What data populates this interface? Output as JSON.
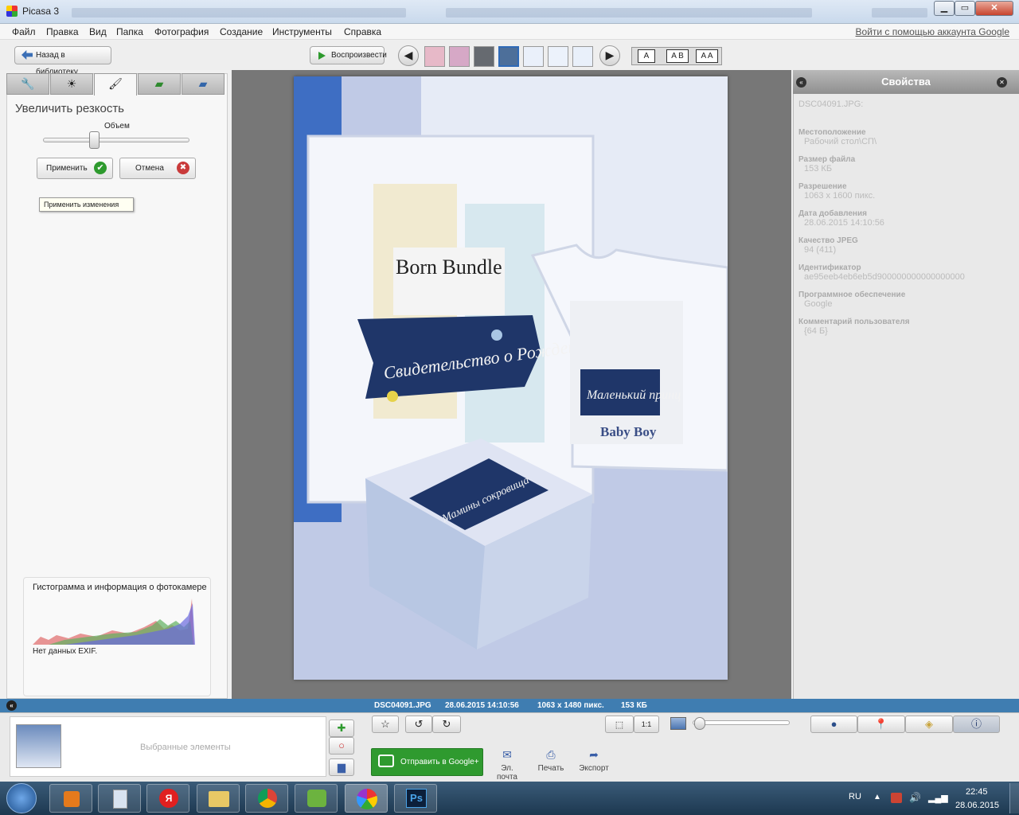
{
  "window": {
    "title": "Picasa 3",
    "minimize": "▁",
    "maximize": "▭",
    "close": "✕"
  },
  "menu": [
    "Файл",
    "Правка",
    "Вид",
    "Папка",
    "Фотография",
    "Создание",
    "Инструменты",
    "Справка"
  ],
  "signin": "Войти с помощью аккаунта Google",
  "toolbar": {
    "back_label": "Назад в библиотеку",
    "play_label": "Воспроизвести",
    "prev": "◀",
    "next": "▶",
    "caption_single": "A",
    "caption_ab": "A B",
    "caption_aa": "A A"
  },
  "left": {
    "tool_title": "Увеличить резкость",
    "slider_label": "Объем",
    "slider_value": 0.35,
    "apply_label": "Применить",
    "cancel_label": "Отмена",
    "tooltip": "Применить изменения",
    "histogram_title": "Гистограмма и информация о фотокамере",
    "exif_text": "Нет данных EXIF."
  },
  "props": {
    "header": "Свойства",
    "filename": "DSC04091.JPG:",
    "items": [
      {
        "k": "Местоположение",
        "v": "Рабочий стол\\СП\\"
      },
      {
        "k": "Размер файла",
        "v": "153 КБ"
      },
      {
        "k": "Разрешение",
        "v": "1063 x 1600 пикс."
      },
      {
        "k": "Дата добавления",
        "v": "28.06.2015 14:10:56"
      },
      {
        "k": "Качество JPEG",
        "v": "94 (411)"
      },
      {
        "k": "Идентификатор",
        "v": "ae95eeb4eb6eb5d900000000000000000"
      },
      {
        "k": "Программное обеспечение",
        "v": "Google"
      },
      {
        "k": "Комментарий пользователя",
        "v": "{64 Б}"
      }
    ]
  },
  "photo_text": {
    "card_title": "Свидетельство о Рождении",
    "onesie_title": "Маленький принц",
    "box_title": "Мамины сокровища",
    "baby_boy": "Baby Boy",
    "bundle": "Born Bundle"
  },
  "status": {
    "file": "DSC04091.JPG",
    "date": "28.06.2015 14:10:56",
    "res": "1063 x 1480 пикс.",
    "size": "153 КБ"
  },
  "bottom": {
    "selected_label": "Выбранные элементы",
    "share_label": "Отправить в Google+",
    "email": "Эл. почта",
    "print": "Печать",
    "export": "Экспорт",
    "zoom_1to1": "1:1"
  },
  "taskbar": {
    "lang": "RU",
    "time": "22:45",
    "date": "28.06.2015"
  },
  "colors": {
    "status_blue": "#3f7db1",
    "share_green": "#2f9a2f",
    "apply_green": "#2e9a2e",
    "cancel_red": "#c93a3a"
  }
}
